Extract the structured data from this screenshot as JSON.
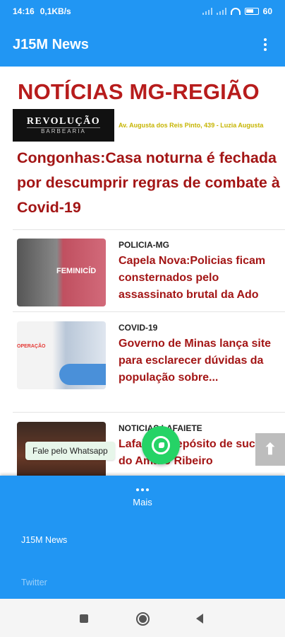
{
  "status_bar": {
    "time": "14:16",
    "network_speed": "0,1KB/s",
    "battery": "60"
  },
  "app_bar": {
    "title": "J15M News",
    "menu_icon": "more-vertical-icon"
  },
  "site": {
    "title": "NOTÍCIAS MG-REGIÃO"
  },
  "banner": {
    "logo_line1": "REVOLUÇÃO",
    "logo_line2": "BARBEARIA",
    "address": "Av. Augusta dos Reis Pinto, 439 - Luzia Augusta"
  },
  "headline": "Congonhas:Casa noturna é fechada por descumprir regras de combate à Covid-19",
  "news_items": [
    {
      "category": "POLICIA-MG",
      "title": "Capela Nova:Policias ficam consternados pelo assassinato brutal da Ado",
      "thumb_text": "FEMINICÍD"
    },
    {
      "category": "COVID-19",
      "title": "Governo de Minas lança site para esclarecer dúvidas da população sobre...",
      "thumb_text": "OPERAÇÃO"
    },
    {
      "category": "NOTICIAS LAFAIETE",
      "title": "Lafaiete: Depósito de sucata do Amaro Ribeiro"
    }
  ],
  "whatsapp": {
    "label": "Fale pelo Whatsapp",
    "icon": "whatsapp-icon"
  },
  "scroll_top": {
    "icon": "arrow-up-icon",
    "glyph": "⬆"
  },
  "bottom_nav": {
    "label": "Mais"
  },
  "drawer": {
    "items": [
      "J15M News",
      "Twitter"
    ]
  },
  "colors": {
    "primary": "#2196f3",
    "headline_red": "#a31515",
    "title_red": "#b71c1c",
    "whatsapp_green": "#25d366"
  }
}
